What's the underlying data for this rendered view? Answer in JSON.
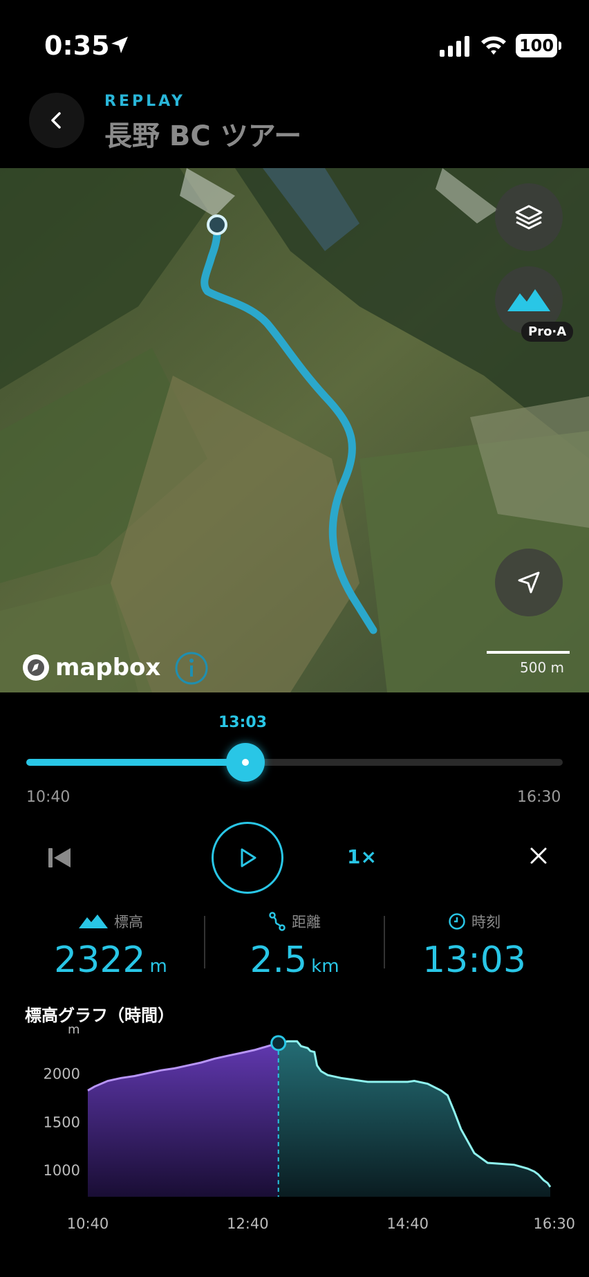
{
  "status_bar": {
    "time": "0:35",
    "battery": "100"
  },
  "header": {
    "replay_label": "REPLAY",
    "title": "長野 BC ツアー"
  },
  "map": {
    "attribution": "mapbox",
    "scale_label": "500 m",
    "pro_badge": "Pro·A"
  },
  "playback": {
    "current_time": "13:03",
    "start_time": "10:40",
    "end_time": "16:30",
    "progress": 0.409,
    "speed": "1×"
  },
  "stats": {
    "elevation": {
      "label": "標高",
      "value": "2322",
      "unit": "m"
    },
    "distance": {
      "label": "距離",
      "value": "2.5",
      "unit": "km"
    },
    "time": {
      "label": "時刻",
      "value": "13:03"
    }
  },
  "colors": {
    "accent": "#29c6e6",
    "elevation_past": "#a37cf0",
    "elevation_future": "#5fe0dc"
  },
  "chart_data": {
    "type": "area",
    "title": "標高グラフ（時間）",
    "ylabel": "m",
    "ylim": [
      800,
      2450
    ],
    "yticks": [
      2000,
      1500,
      1000
    ],
    "xlim_minutes": [
      630,
      990
    ],
    "xticks": [
      {
        "label": "10:40",
        "minute": 640
      },
      {
        "label": "12:40",
        "minute": 760
      },
      {
        "label": "14:40",
        "minute": 880
      },
      {
        "label": "16:30",
        "minute": 990
      }
    ],
    "current_minute": 783,
    "x": [
      "10:40",
      "10:45",
      "10:55",
      "11:05",
      "11:15",
      "11:25",
      "11:35",
      "11:45",
      "11:55",
      "12:05",
      "12:15",
      "12:25",
      "12:35",
      "12:45",
      "12:55",
      "13:03",
      "13:10",
      "13:17",
      "13:20",
      "13:25",
      "13:27",
      "13:30",
      "13:32",
      "13:35",
      "13:40",
      "13:50",
      "14:00",
      "14:10",
      "14:20",
      "14:30",
      "14:40",
      "14:45",
      "14:55",
      "15:05",
      "15:10",
      "15:15",
      "15:20",
      "15:30",
      "15:40",
      "15:50",
      "16:00",
      "16:10",
      "16:15",
      "16:18",
      "16:22",
      "16:25",
      "16:27"
    ],
    "series": [
      {
        "values": [
          1830,
          1870,
          1930,
          1960,
          1980,
          2010,
          2040,
          2060,
          2090,
          2120,
          2160,
          2190,
          2220,
          2250,
          2290,
          2322,
          2340,
          2340,
          2290,
          2270,
          2240,
          2230,
          2090,
          2030,
          1990,
          1960,
          1940,
          1920,
          1920,
          1920,
          1920,
          1930,
          1900,
          1830,
          1780,
          1610,
          1430,
          1180,
          1080,
          1070,
          1060,
          1020,
          990,
          960,
          900,
          870,
          830
        ]
      }
    ]
  }
}
